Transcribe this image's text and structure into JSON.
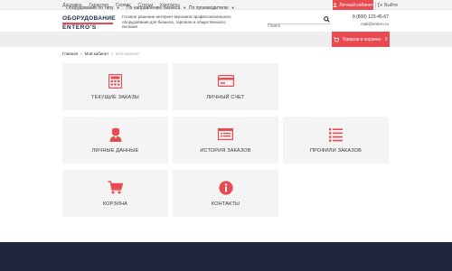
{
  "topbar": {
    "links": [
      "Доставка",
      "Гарантия",
      "Сервис",
      "Статьи",
      "Контакты"
    ],
    "account_label": "Личный кабинет",
    "logout_label": "Выйти"
  },
  "header": {
    "logo_line1": "ОБОРУДОВАНИЕ",
    "logo_line2": "ENTERO'S",
    "tagline": "Готовое решение интернет-магазина профессионального оборудования для бизнеса, торговли и общественного питания",
    "search_placeholder": "Поиск",
    "phone": "8 (800) 123-45-67",
    "email": "mail@entero.ru"
  },
  "nav": {
    "items": [
      "Оборудование по типу",
      "По направлению бизнеса",
      "По производителю"
    ],
    "cart_label": "Товаров в корзине:",
    "cart_count": "2"
  },
  "breadcrumb": {
    "items": [
      "Главная",
      "Мой кабинет",
      "Мой кабинет"
    ]
  },
  "tiles": [
    {
      "label": "ТЕКУЩИЕ ЗАКАЗЫ",
      "icon": "calculator-icon"
    },
    {
      "label": "ЛИЧНЫЙ СЧЕТ",
      "icon": "credit-card-icon"
    },
    {
      "label": "ЛИЧНЫЕ ДАННЫЕ",
      "icon": "user-profile-icon"
    },
    {
      "label": "ИСТОРИЯ ЗАКАЗОВ",
      "icon": "history-list-icon"
    },
    {
      "label": "ПРОФИЛИ ЗАКАЗОВ",
      "icon": "list-icon"
    },
    {
      "label": "КОРЗИНА",
      "icon": "cart-icon"
    },
    {
      "label": "КОНТАКТЫ",
      "icon": "info-icon"
    }
  ],
  "colors": {
    "accent": "#e84a4f",
    "footer": "#1e2640",
    "nav_bg": "#eeeef0",
    "tile_bg": "#f4f4f5"
  }
}
